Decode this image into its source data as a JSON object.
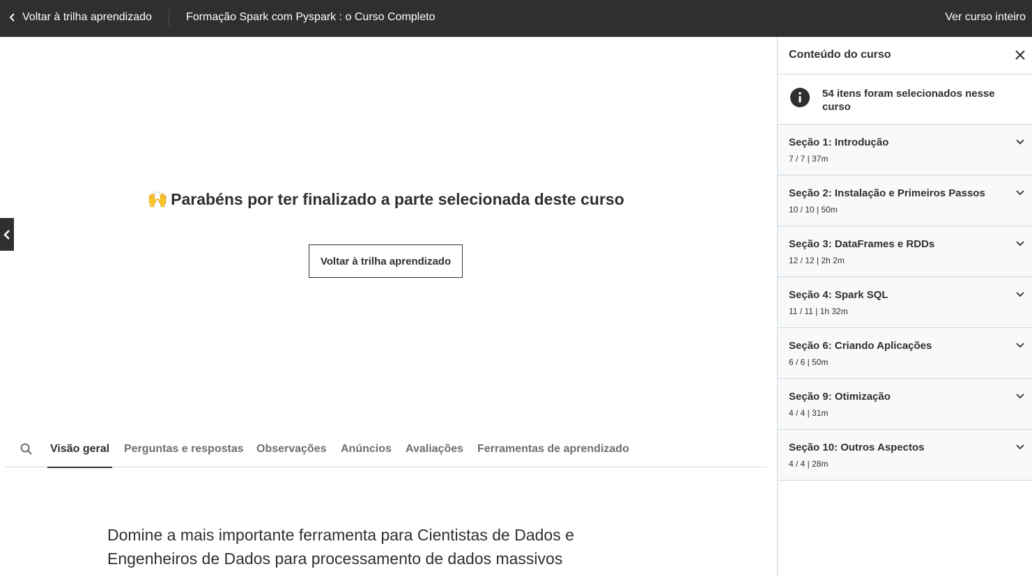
{
  "topbar": {
    "back_label": "Voltar à trilha aprendizado",
    "course_title": "Formação Spark com Pyspark : o Curso Completo",
    "full_course_label": "Ver curso inteiro"
  },
  "main": {
    "completion_emoji": "🙌",
    "completion_heading": "Parabéns por ter finalizado a parte selecionada deste curso",
    "completion_button": "Voltar à trilha aprendizado",
    "tabs": [
      {
        "label": "Visão geral",
        "active": true
      },
      {
        "label": "Perguntas e respostas",
        "active": false
      },
      {
        "label": "Observações",
        "active": false
      },
      {
        "label": "Anúncios",
        "active": false
      },
      {
        "label": "Avaliações",
        "active": false
      },
      {
        "label": "Ferramentas de aprendizado",
        "active": false
      }
    ],
    "description": "Domine a mais importante ferramenta para Cientistas de Dados e Engenheiros de Dados para processamento de dados massivos"
  },
  "sidebar": {
    "title": "Conteúdo do curso",
    "info_text": "54 itens foram selecionados nesse curso",
    "sections": [
      {
        "title": "Seção 1: Introdução",
        "meta": "7 / 7 | 37m"
      },
      {
        "title": "Seção 2: Instalação e Primeiros Passos",
        "meta": "10 / 10 | 50m"
      },
      {
        "title": "Seção 3: DataFrames e RDDs",
        "meta": "12 / 12 | 2h 2m"
      },
      {
        "title": "Seção 4: Spark SQL",
        "meta": "11 / 11 | 1h 32m"
      },
      {
        "title": "Seção 6: Criando Aplicações",
        "meta": "6 / 6 | 50m"
      },
      {
        "title": "Seção 9: Otimização",
        "meta": "4 / 4 | 31m"
      },
      {
        "title": "Seção 10: Outros Aspectos",
        "meta": "4 / 4 | 28m"
      }
    ]
  },
  "colors": {
    "topbar_bg": "#2d2f31",
    "section_bg": "#f7f9fa",
    "border": "#d1d7dc",
    "text": "#2d2f31",
    "muted_text": "#6a6f73"
  },
  "icons": [
    "chevron-left-icon",
    "expand-sidebar-icon",
    "search-icon",
    "close-icon",
    "info-icon",
    "chevron-down-icon"
  ]
}
